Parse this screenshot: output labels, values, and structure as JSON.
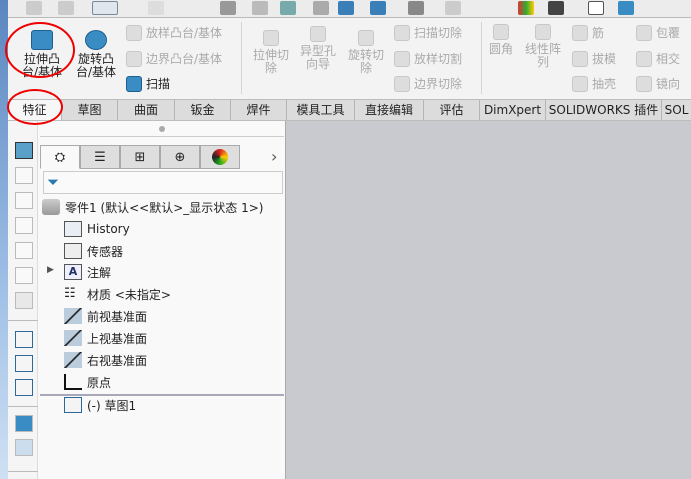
{
  "ribbon": {
    "extrude_boss": "拉伸凸台/基体",
    "revolve_boss": "旋转凸台/基体",
    "loft_boss": "放样凸台/基体",
    "boundary_boss": "边界凸台/基体",
    "sweep": "扫描",
    "extrude_cut": "拉伸切除",
    "hole_wizard": "异型孔向导",
    "revolve_cut": "旋转切除",
    "swept_cut": "扫描切除",
    "lofted_cut": "放样切割",
    "boundary_cut": "边界切除",
    "fillet": "圆角",
    "linear_pattern": "线性阵列",
    "rib": "筋",
    "draft": "拔模",
    "shell": "抽壳",
    "wrap": "包覆",
    "intersect": "相交",
    "mirror": "镜向"
  },
  "tabs": [
    "特征",
    "草图",
    "曲面",
    "钣金",
    "焊件",
    "模具工具",
    "直接编辑",
    "评估",
    "DimXpert",
    "SOLIDWORKS 插件",
    "SOL"
  ],
  "tree": {
    "root": "零件1  (默认<<默认>_显示状态 1>)",
    "items": [
      "History",
      "传感器",
      "注解",
      "材质 <未指定>",
      "前视基准面",
      "上视基准面",
      "右视基准面",
      "原点",
      "(-) 草图1"
    ]
  },
  "panel_tabs": [
    "feature-manager",
    "property-manager",
    "configuration-manager",
    "dimxpert-manager",
    "display-manager"
  ]
}
